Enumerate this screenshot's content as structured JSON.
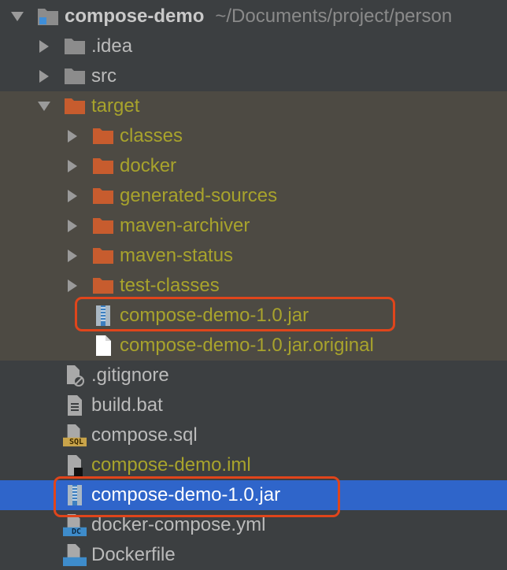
{
  "project": {
    "name": "compose-demo",
    "path": "~/Documents/project/person"
  },
  "tree": [
    {
      "label": ".idea",
      "icon": "folder-icon",
      "style": "normal"
    },
    {
      "label": "src",
      "icon": "folder-icon",
      "style": "normal"
    },
    {
      "label": "target",
      "icon": "folder-orange-icon",
      "style": "olive"
    },
    {
      "label": "classes",
      "icon": "folder-orange-icon",
      "style": "olive"
    },
    {
      "label": "docker",
      "icon": "folder-orange-icon",
      "style": "olive"
    },
    {
      "label": "generated-sources",
      "icon": "folder-orange-icon",
      "style": "olive"
    },
    {
      "label": "maven-archiver",
      "icon": "folder-orange-icon",
      "style": "olive"
    },
    {
      "label": "maven-status",
      "icon": "folder-orange-icon",
      "style": "olive"
    },
    {
      "label": "test-classes",
      "icon": "folder-orange-icon",
      "style": "olive"
    },
    {
      "label": "compose-demo-1.0.jar",
      "icon": "jar-file-icon",
      "style": "olive"
    },
    {
      "label": "compose-demo-1.0.jar.original",
      "icon": "text-file-icon",
      "style": "olive"
    },
    {
      "label": ".gitignore",
      "icon": "gitignore-file-icon",
      "style": "normal"
    },
    {
      "label": "build.bat",
      "icon": "text-file-icon",
      "style": "normal"
    },
    {
      "label": "compose.sql",
      "icon": "sql-file-icon",
      "style": "normal"
    },
    {
      "label": "compose-demo.iml",
      "icon": "iml-file-icon",
      "style": "olive"
    },
    {
      "label": "compose-demo-1.0.jar",
      "icon": "jar-file-icon",
      "style": "selected"
    },
    {
      "label": "docker-compose.yml",
      "icon": "docker-compose-file-icon",
      "style": "normal"
    },
    {
      "label": "Dockerfile",
      "icon": "dockerfile-icon",
      "style": "normal"
    }
  ],
  "icon_badges": {
    "sql": "SQL",
    "docker": "DC"
  },
  "colors": {
    "background": "#3c3f41",
    "excluded_background": "#4d4a43",
    "selection": "#2f65ca",
    "excluded_text": "#a8a32c",
    "highlight_border": "#e0451b"
  }
}
